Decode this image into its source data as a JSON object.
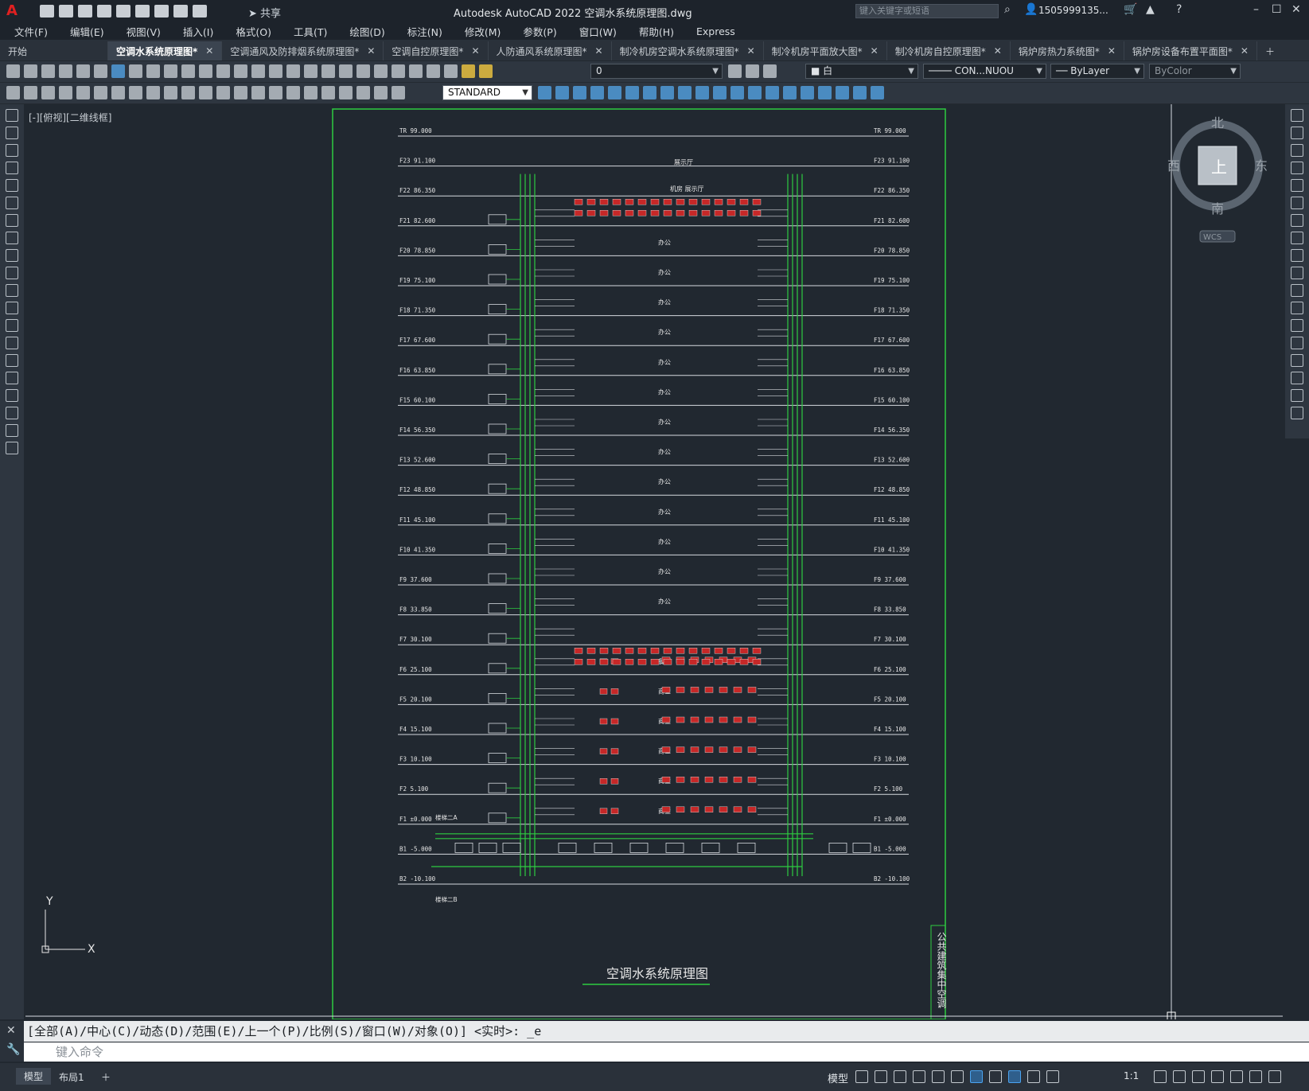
{
  "app": {
    "title": "Autodesk AutoCAD 2022    空调水系统原理图.dwg",
    "share_label": "共享",
    "search_placeholder": "键入关键字或短语",
    "user": "1505999135..."
  },
  "menu": [
    "文件(F)",
    "编辑(E)",
    "视图(V)",
    "插入(I)",
    "格式(O)",
    "工具(T)",
    "绘图(D)",
    "标注(N)",
    "修改(M)",
    "参数(P)",
    "窗口(W)",
    "帮助(H)",
    "Express"
  ],
  "tabs": [
    {
      "label": "开始",
      "closable": false
    },
    {
      "label": "空调水系统原理图*",
      "closable": true,
      "active": true
    },
    {
      "label": "空调通风及防排烟系统原理图*",
      "closable": true
    },
    {
      "label": "空调自控原理图*",
      "closable": true
    },
    {
      "label": "人防通风系统原理图*",
      "closable": true
    },
    {
      "label": "制冷机房空调水系统原理图*",
      "closable": true
    },
    {
      "label": "制冷机房平面放大图*",
      "closable": true
    },
    {
      "label": "制冷机房自控原理图*",
      "closable": true
    },
    {
      "label": "锅炉房热力系统图*",
      "closable": true
    },
    {
      "label": "锅炉房设备布置平面图*",
      "closable": true
    }
  ],
  "toolbar": {
    "layer": "0",
    "color": "白",
    "linetype": "CON...NUOU",
    "lineweight": "ByLayer",
    "plotstyle": "ByColor",
    "textstyle": "STANDARD"
  },
  "viewport_label": "[-][俯视][二维线框]",
  "viewcube": {
    "north": "北",
    "south": "南",
    "east": "东",
    "west": "西",
    "top": "上",
    "wcs": "WCS"
  },
  "ucs": {
    "x": "X",
    "y": "Y"
  },
  "drawing": {
    "title": "空调水系统原理图",
    "side_label": "公共建筑集中空调",
    "floors_left": [
      {
        "name": "TR",
        "elev": "99.000"
      },
      {
        "name": "F23",
        "elev": "91.100"
      },
      {
        "name": "F22",
        "elev": "86.350"
      },
      {
        "name": "F21",
        "elev": "82.600"
      },
      {
        "name": "F20",
        "elev": "78.850"
      },
      {
        "name": "F19",
        "elev": "75.100"
      },
      {
        "name": "F18",
        "elev": "71.350"
      },
      {
        "name": "F17",
        "elev": "67.600"
      },
      {
        "name": "F16",
        "elev": "63.850"
      },
      {
        "name": "F15",
        "elev": "60.100"
      },
      {
        "name": "F14",
        "elev": "56.350"
      },
      {
        "name": "F13",
        "elev": "52.600"
      },
      {
        "name": "F12",
        "elev": "48.850"
      },
      {
        "name": "F11",
        "elev": "45.100"
      },
      {
        "name": "F10",
        "elev": "41.350"
      },
      {
        "name": "F9",
        "elev": "37.600"
      },
      {
        "name": "F8",
        "elev": "33.850"
      },
      {
        "name": "F7",
        "elev": "30.100"
      },
      {
        "name": "F6",
        "elev": "25.100"
      },
      {
        "name": "F5",
        "elev": "20.100"
      },
      {
        "name": "F4",
        "elev": "15.100"
      },
      {
        "name": "F3",
        "elev": "10.100"
      },
      {
        "name": "F2",
        "elev": "5.100"
      },
      {
        "name": "F1",
        "elev": "±0.000"
      },
      {
        "name": "B1",
        "elev": "-5.000"
      },
      {
        "name": "B2",
        "elev": "-10.100"
      }
    ],
    "floor_labels": {
      "F23": "展示厅",
      "F22": "机房   展示厅",
      "office": "办公",
      "F6": "餐厅",
      "commercial": "商业",
      "F1": "商业"
    },
    "stair_labels": [
      "楼梯二A",
      "楼梯二B"
    ]
  },
  "command": {
    "history": "[全部(A)/中心(C)/动态(D)/范围(E)/上一个(P)/比例(S)/窗口(W)/对象(O)] <实时>: _e",
    "placeholder": "键入命令"
  },
  "status": {
    "tabs": [
      "模型",
      "布局1"
    ],
    "model": "模型",
    "scale": "1:1"
  },
  "colors": {
    "bg": "#212830",
    "frame": "#2ecc40",
    "pipe": "#2ecc40",
    "line": "#e6e6e6",
    "red": "#c62828"
  }
}
